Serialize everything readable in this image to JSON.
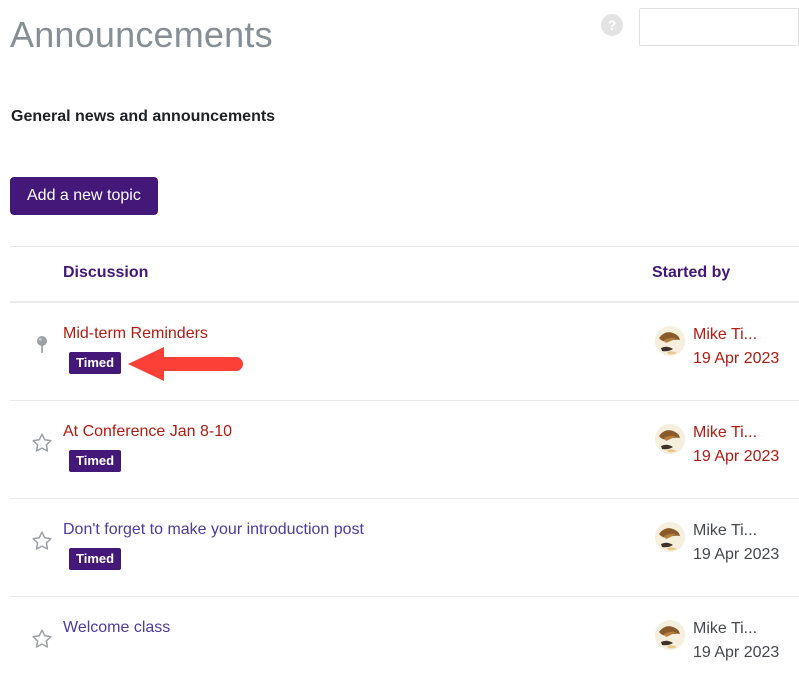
{
  "header": {
    "title": "Announcements",
    "help_icon": "question-mark-icon",
    "help_label": "?",
    "search_value": "",
    "search_placeholder": ""
  },
  "intro": {
    "description": "General news and announcements"
  },
  "toolbar": {
    "add_topic_label": "Add a new topic"
  },
  "table": {
    "columns": {
      "discussion": "Discussion",
      "started_by": "Started by"
    },
    "rows": [
      {
        "flag_icon": "pin-icon",
        "subject": "Mid-term Reminders",
        "subject_state": "visited",
        "badge": "Timed",
        "starter_name": "Mike Ti...",
        "starter_date": "19 Apr 2023",
        "starter_state": "visited"
      },
      {
        "flag_icon": "star-icon",
        "subject": "At Conference Jan 8-10",
        "subject_state": "visited",
        "badge": "Timed",
        "starter_name": "Mike Ti...",
        "starter_date": "19 Apr 2023",
        "starter_state": "visited"
      },
      {
        "flag_icon": "star-icon",
        "subject": "Don't forget to make your introduction post",
        "subject_state": "unvisited",
        "badge": "Timed",
        "starter_name": "Mike Ti...",
        "starter_date": "19 Apr 2023",
        "starter_state": "default"
      },
      {
        "flag_icon": "star-icon",
        "subject": "Welcome class",
        "subject_state": "unvisited",
        "badge": "",
        "starter_name": "Mike Ti...",
        "starter_date": "19 Apr 2023",
        "starter_state": "default"
      }
    ]
  },
  "annotation": {
    "arrow_icon": "left-arrow-annotation",
    "arrow_color": "#fb4038",
    "points_at": "Timed"
  },
  "colors": {
    "brand_purple": "#431878",
    "visited_link": "#b31a11",
    "unvisited_link": "#4f3a9e",
    "title_grey": "#868e96",
    "divider": "#e9eaf0"
  }
}
